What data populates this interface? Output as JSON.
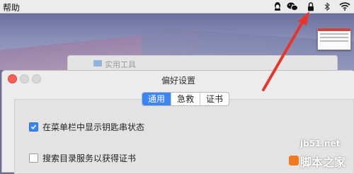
{
  "menubar": {
    "help_label": "帮助",
    "tray_icons": [
      "qq-icon",
      "wechat-icon",
      "lock-icon",
      "bluetooth-icon",
      "wifi-icon"
    ]
  },
  "background_window": {
    "title": "实用工具",
    "icon": "folder-icon"
  },
  "prefs": {
    "title": "偏好设置",
    "tabs": [
      {
        "label": "通用",
        "active": true
      },
      {
        "label": "急救",
        "active": false
      },
      {
        "label": "证书",
        "active": false
      }
    ],
    "options": [
      {
        "label": "在菜单栏中显示钥匙串状态",
        "checked": true
      },
      {
        "label": "搜索目录服务以获得证书",
        "checked": false
      }
    ]
  },
  "watermark": {
    "site": "jb51.net",
    "brand": "脚本之家"
  },
  "colors": {
    "accent": "#3a86f7",
    "arrow": "#e8352a",
    "close": "#ff5f57"
  }
}
